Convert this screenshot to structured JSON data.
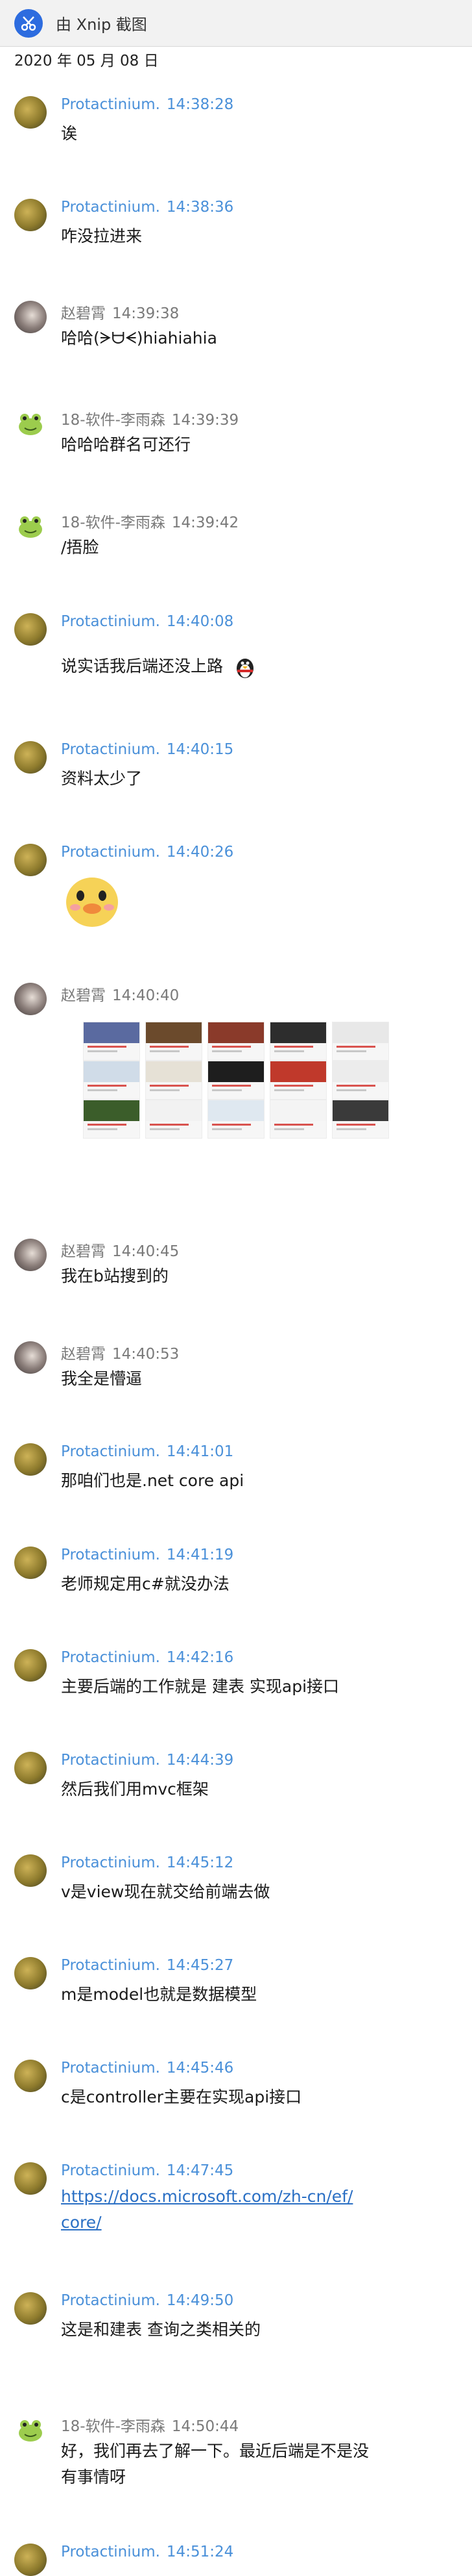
{
  "window": {
    "title": "由 Xnip 截图",
    "icon": "scissors-icon"
  },
  "date": "2020 年 05 月 08 日",
  "users": {
    "protactinium": "Protactinium.",
    "zhao": "赵碧霄",
    "li": "18-软件-李雨森"
  },
  "messages": [
    {
      "name": "Protactinium.",
      "time": "14:38:28",
      "text": "诶"
    },
    {
      "name": "Protactinium.",
      "time": "14:38:36",
      "text": "咋没拉进来"
    },
    {
      "name": "赵碧霄",
      "time": "14:39:38",
      "text": "哈哈(ᗒᗨᗕ)hiahiahia"
    },
    {
      "name": "18-软件-李雨森",
      "time": "14:39:39",
      "text": "哈哈哈群名可还行"
    },
    {
      "name": "18-软件-李雨森",
      "time": "14:39:42",
      "text": "/捂脸"
    },
    {
      "name": "Protactinium.",
      "time": "14:40:08",
      "text": "说实话我后端还没上路"
    },
    {
      "name": "Protactinium.",
      "time": "14:40:15",
      "text": "资料太少了"
    },
    {
      "name": "Protactinium.",
      "time": "14:40:26",
      "text": ""
    },
    {
      "name": "赵碧霄",
      "time": "14:40:40",
      "text": ""
    },
    {
      "name": "赵碧霄",
      "time": "14:40:45",
      "text": "我在b站搜到的"
    },
    {
      "name": "赵碧霄",
      "time": "14:40:53",
      "text": "我全是懵逼"
    },
    {
      "name": "Protactinium.",
      "time": "14:41:01",
      "text": "那咱们也是.net core api"
    },
    {
      "name": "Protactinium.",
      "time": "14:41:19",
      "text": "老师规定用c#就没办法"
    },
    {
      "name": "Protactinium.",
      "time": "14:42:16",
      "text": "主要后端的工作就是 建表 实现api接口"
    },
    {
      "name": "Protactinium.",
      "time": "14:44:39",
      "text": "然后我们用mvc框架"
    },
    {
      "name": "Protactinium.",
      "time": "14:45:12",
      "text": "v是view现在就交给前端去做"
    },
    {
      "name": "Protactinium.",
      "time": "14:45:27",
      "text": "m是model也就是数据模型"
    },
    {
      "name": "Protactinium.",
      "time": "14:45:46",
      "text": "c是controller主要在实现api接口"
    },
    {
      "name": "Protactinium.",
      "time": "14:47:45",
      "link1": "https://docs.microsoft.com/zh-cn/ef/",
      "link2": "core/"
    },
    {
      "name": "Protactinium.",
      "time": "14:49:50",
      "text": "这是和建表 查询之类相关的"
    },
    {
      "name": "18-软件-李雨森",
      "time": "14:50:44",
      "text1": "好，我们再去了解一下。最近后端是不是没",
      "text2": "有事情呀"
    },
    {
      "name": "Protactinium.",
      "time": "14:51:24"
    }
  ],
  "colors": {
    "name_blue": "#4a90d9",
    "name_gray": "#7a7a7a",
    "link": "#2a6fc4",
    "topbar": "#f2f2f2"
  },
  "icons": {
    "qq_emoji": "penguin-icon",
    "sticker": "yellow-duck-sticker"
  }
}
